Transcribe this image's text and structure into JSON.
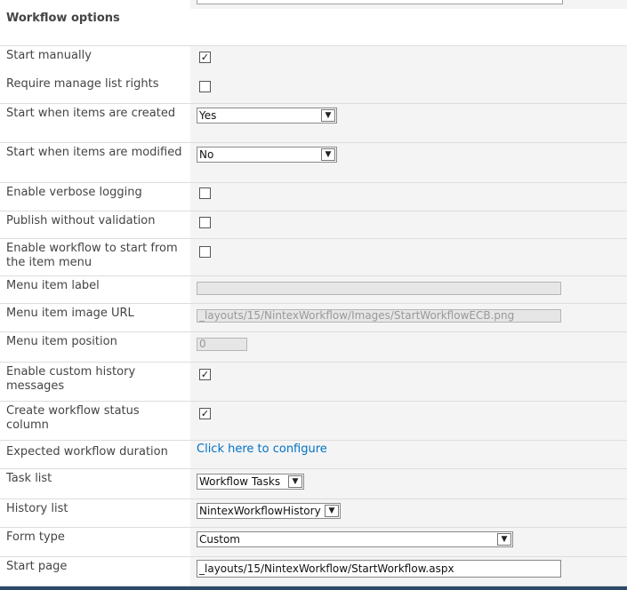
{
  "section": {
    "title": "Workflow options"
  },
  "rows": {
    "start_manually": {
      "label": "Start manually",
      "checked": true
    },
    "require_manage_list_rights": {
      "label": "Require manage list rights",
      "checked": false
    },
    "start_when_created": {
      "label": "Start when items are created",
      "selected": "Yes"
    },
    "start_when_modified": {
      "label": "Start when items are modified",
      "selected": "No"
    },
    "verbose_logging": {
      "label": "Enable verbose logging",
      "checked": false
    },
    "publish_without_validation": {
      "label": "Publish without validation",
      "checked": false
    },
    "start_from_item_menu": {
      "label": "Enable workflow to start from the item menu",
      "checked": false
    },
    "menu_item_label": {
      "label": "Menu item label",
      "value": ""
    },
    "menu_item_image_url": {
      "label": "Menu item image URL",
      "value": "_layouts/15/NintexWorkflow/Images/StartWorkflowECB.png"
    },
    "menu_item_position": {
      "label": "Menu item position",
      "value": "0"
    },
    "custom_history_messages": {
      "label": "Enable custom history messages",
      "checked": true
    },
    "workflow_status_column": {
      "label": "Create workflow status column",
      "checked": true
    },
    "expected_duration": {
      "label": "Expected workflow duration",
      "link": "Click here to configure"
    },
    "task_list": {
      "label": "Task list",
      "selected": "Workflow Tasks"
    },
    "history_list": {
      "label": "History list",
      "selected": "NintexWorkflowHistory"
    },
    "form_type": {
      "label": "Form type",
      "selected": "Custom"
    },
    "start_page": {
      "label": "Start page",
      "value": "_layouts/15/NintexWorkflow/StartWorkflow.aspx"
    }
  },
  "glyphs": {
    "check": "✓",
    "dropdown_arrow": "▼"
  },
  "colors": {
    "link": "#0072c6",
    "value_cell_bg": "#f4f4f4"
  }
}
